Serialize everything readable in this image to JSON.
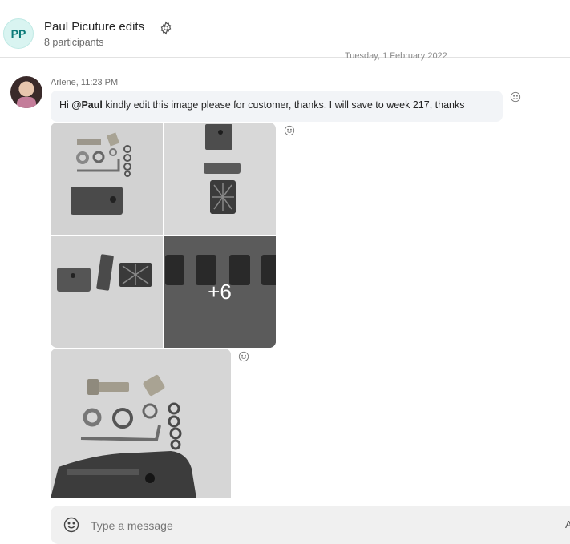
{
  "header": {
    "avatar_initials": "PP",
    "title": "Paul Picuture edits",
    "participants": "8 participants",
    "settings_icon": "gear-icon"
  },
  "date_separator": "Tuesday, 1 February 2022",
  "message": {
    "sender": "Arlene",
    "time": "11:23 PM",
    "meta": "Arlene, 11:23 PM",
    "text_prefix": "Hi ",
    "mention": "@Paul",
    "text_suffix": " kindly edit this image please for customer, thanks. I will save to week 217, thanks",
    "reaction_icon": "smiley-icon"
  },
  "image_grid": {
    "more_count": "+6"
  },
  "composer": {
    "placeholder": "Type a message",
    "emoji_icon": "smiley-icon",
    "format_label": "A"
  },
  "colors": {
    "avatar_bg": "#d9f4f1",
    "avatar_text": "#0a7a78",
    "bubble_bg": "#f2f4f7",
    "composer_bg": "#f0f0f0"
  }
}
